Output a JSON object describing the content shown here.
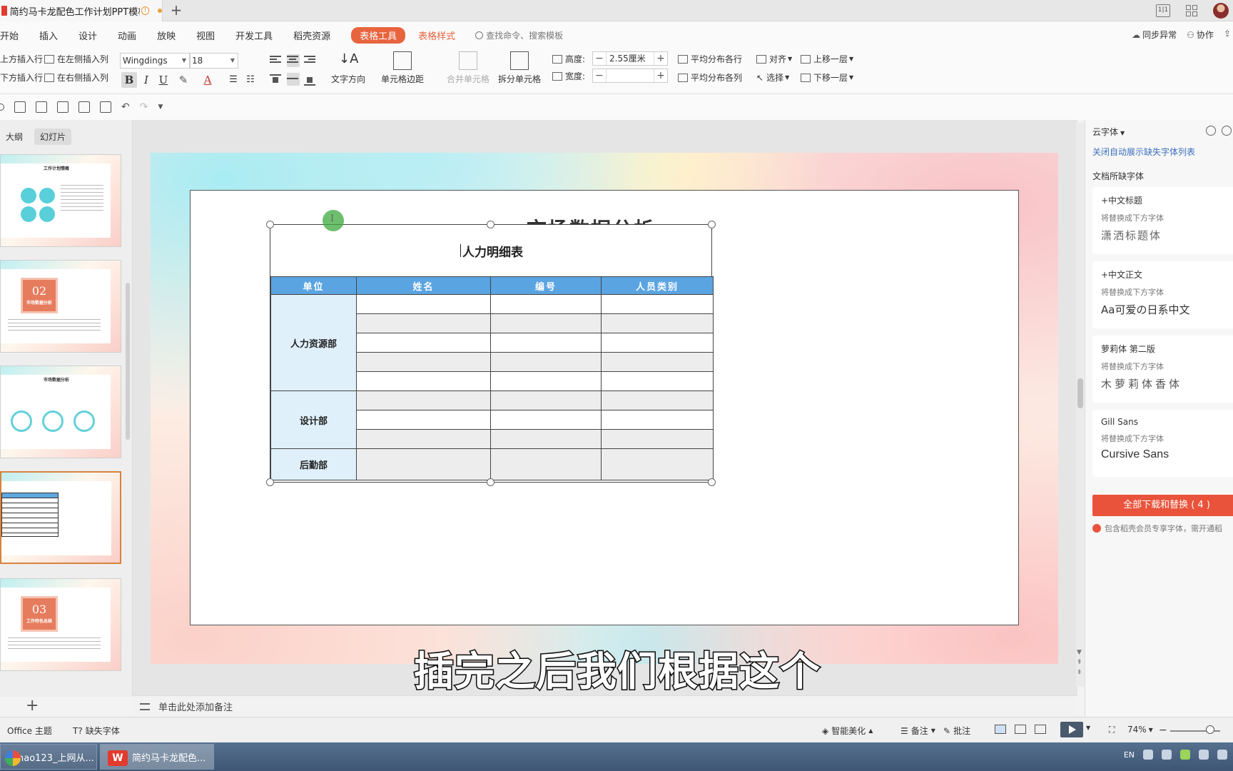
{
  "window": {
    "doc_tab_title": "简约马卡龙配色工作计划PPT模板",
    "warn_glyph": "!",
    "new_tab": "+",
    "layout_toggle": "1|1"
  },
  "menu": {
    "items": [
      "开始",
      "插入",
      "设计",
      "动画",
      "放映",
      "视图",
      "开发工具",
      "稻壳资源"
    ],
    "active_pill": "表格工具",
    "orange_tab": "表格样式",
    "search_placeholder": "查找命令、搜索模板",
    "right": [
      "同步异常",
      "协作"
    ]
  },
  "ribbon": {
    "insert_above": "上方插入行",
    "insert_below": "下方插入行",
    "insert_left": "在左侧插入列",
    "insert_right": "在右侧插入列",
    "font_name": "Wingdings",
    "font_size": "18",
    "bold": "B",
    "italic": "I",
    "underline": "U",
    "text_direction": "文字方向",
    "cell_margin": "单元格边距",
    "merge_cells": "合并单元格",
    "split_cells": "拆分单元格",
    "height_label": "高度:",
    "height_value": "2.55厘米",
    "width_label": "宽度:",
    "width_value": "",
    "distribute_rows": "平均分布各行",
    "distribute_cols": "平均分布各列",
    "align": "对齐",
    "select": "选择",
    "bring_forward": "上移一层",
    "send_backward": "下移一层"
  },
  "left_pane": {
    "tab_outline": "大纲",
    "tab_slides": "幻灯片",
    "thumb1_title": "工作计划情概",
    "thumb2_number": "02",
    "thumb2_caption": "市场数据分析",
    "thumb3_title": "市场数据分析",
    "thumb5_number": "03",
    "thumb5_caption": "工作特色总结",
    "add_slide": "+"
  },
  "slide": {
    "heading": "市场数据分析",
    "table_title": "人力明细表",
    "headers": [
      "单位",
      "姓名",
      "编号",
      "人员类别"
    ],
    "departments": [
      "人力资源部",
      "设计部",
      "后勤部"
    ]
  },
  "subtitle": "插完之后我们根据这个",
  "notes_placeholder": "单击此处添加备注",
  "right_pane": {
    "header": "云字体",
    "close_link": "关闭自动展示缺失字体列表",
    "missing_label": "文档所缺字体",
    "cards": [
      {
        "name": "+中文标题",
        "sub": "将替换成下方字体",
        "sample": "潇洒标题体"
      },
      {
        "name": "+中文正文",
        "sub": "将替换成下方字体",
        "sample": "Aa可爱の日系中文"
      },
      {
        "name": "萝莉体 第二版",
        "sub": "将替换成下方字体",
        "sample": "木萝莉体香体"
      },
      {
        "name": "Gill Sans",
        "sub": "将替换成下方字体",
        "sample": "Cursive Sans"
      }
    ],
    "download_button": "全部下载和替换 ( 4 )",
    "member_note": "包含稻壳会员专享字体，需开通稻"
  },
  "statusbar": {
    "theme": "Office 主题",
    "missing_font": "缺失字体",
    "smart_beautify": "智能美化",
    "notes": "备注",
    "comments": "批注",
    "zoom": "74%"
  },
  "taskbar": {
    "item1": "hao123_上网从...",
    "item2": "简约马卡龙配色...",
    "lang": "EN"
  }
}
